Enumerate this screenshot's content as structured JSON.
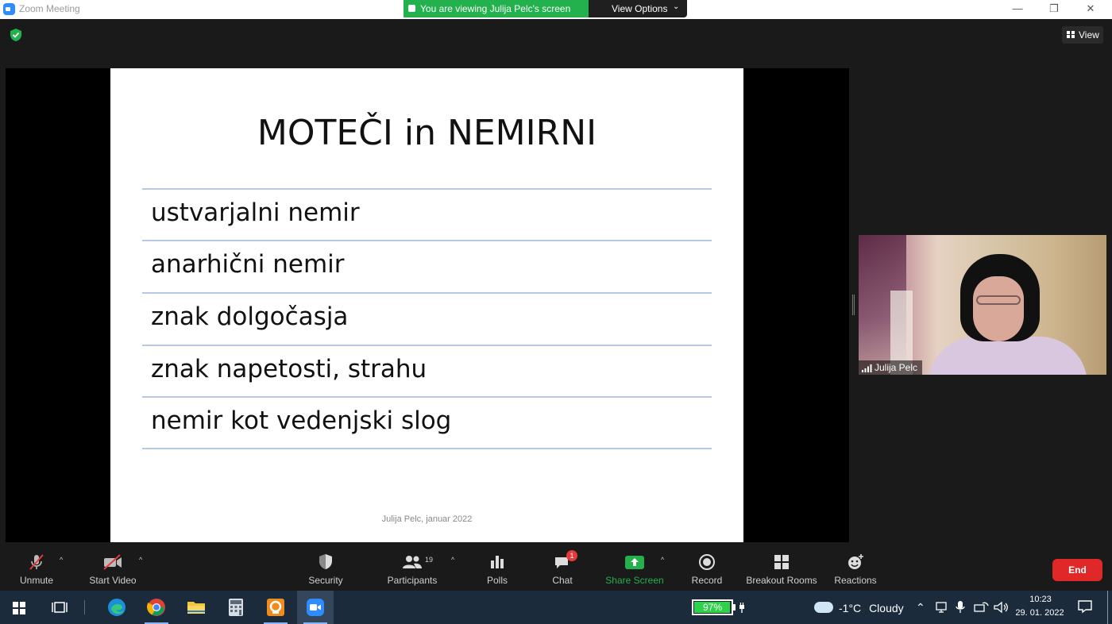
{
  "window": {
    "title": "Zoom Meeting",
    "controls": {
      "minimize": "—",
      "maximize": "❐",
      "close": "✕"
    }
  },
  "banner": {
    "viewing_text": "You are viewing Julija Pelc's screen",
    "view_options_label": "View Options"
  },
  "top": {
    "view_label": "View"
  },
  "slide": {
    "title": "MOTEČI in NEMIRNI",
    "items": [
      "ustvarjalni nemir",
      "anarhični nemir",
      "znak dolgočasja",
      "znak napetosti, strahu",
      "nemir kot vedenjski slog"
    ],
    "footer": "Julija Pelc, januar 2022"
  },
  "video": {
    "participant_name": "Julija Pelc"
  },
  "toolbar": {
    "unmute": "Unmute",
    "start_video": "Start Video",
    "security": "Security",
    "participants": "Participants",
    "participants_count": "19",
    "polls": "Polls",
    "chat": "Chat",
    "chat_badge": "1",
    "share_screen": "Share Screen",
    "record": "Record",
    "breakout_rooms": "Breakout Rooms",
    "reactions": "Reactions",
    "end": "End"
  },
  "taskbar": {
    "apps": [
      "edge-icon",
      "chrome-icon",
      "file-explorer-icon",
      "calculator-icon",
      "presentation-app-icon",
      "zoom-icon"
    ],
    "battery_percent": "97%",
    "battery_level": 0.97,
    "weather_temp": "-1°C",
    "weather_desc": "Cloudy",
    "time": "10:23",
    "date": "29. 01. 2022"
  },
  "colors": {
    "zoom_green": "#23b14d",
    "end_red": "#e02828",
    "zoom_blue": "#2d8cff",
    "taskbar_bg": "#1c2b3c"
  }
}
